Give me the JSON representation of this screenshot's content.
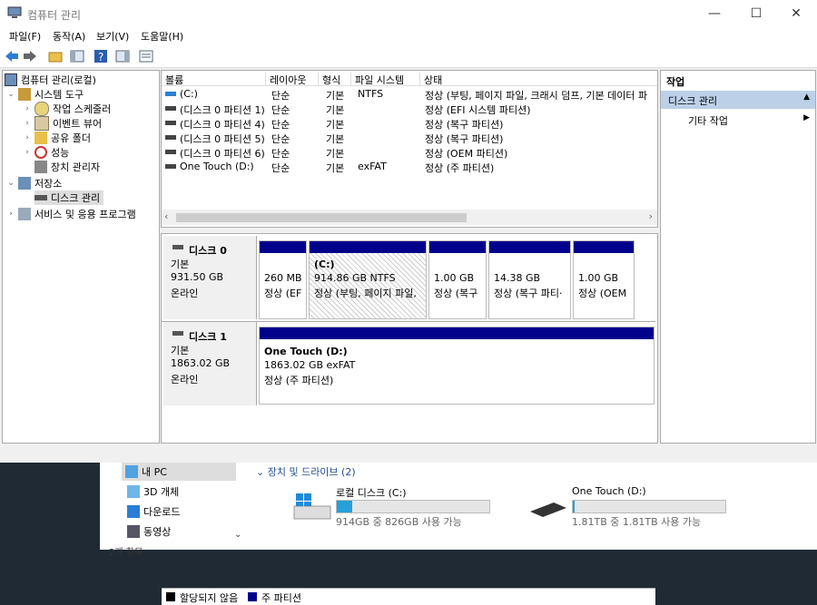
{
  "window": {
    "title": "컴퓨터 관리"
  },
  "menu": [
    "파일(F)",
    "동작(A)",
    "보기(V)",
    "도움말(H)"
  ],
  "tree": {
    "root": "컴퓨터 관리(로컬)",
    "system_tools": "시스템 도구",
    "items": [
      "작업 스케줄러",
      "이벤트 뷰어",
      "공유 폴더",
      "성능",
      "장치 관리자"
    ],
    "storage": "저장소",
    "disk_mgmt": "디스크 관리",
    "services": "서비스 및 응용 프로그램"
  },
  "volumes": {
    "headers": [
      "볼륨",
      "레이아웃",
      "형식",
      "파일 시스템",
      "상태"
    ],
    "rows": [
      [
        "(C:)",
        "단순",
        "기본",
        "NTFS",
        "정상 (부팅, 페이지 파일, 크래시 덤프, 기본 데이터 파"
      ],
      [
        "(디스크 0 파티션 1)",
        "단순",
        "기본",
        "",
        "정상 (EFI 시스템 파티션)"
      ],
      [
        "(디스크 0 파티션 4)",
        "단순",
        "기본",
        "",
        "정상 (복구 파티션)"
      ],
      [
        "(디스크 0 파티션 5)",
        "단순",
        "기본",
        "",
        "정상 (복구 파티션)"
      ],
      [
        "(디스크 0 파티션 6)",
        "단순",
        "기본",
        "",
        "정상 (OEM 파티션)"
      ],
      [
        "One Touch (D:)",
        "단순",
        "기본",
        "exFAT",
        "정상 (주 파티션)"
      ]
    ]
  },
  "disks": [
    {
      "name": "디스크 0",
      "type": "기본",
      "size": "931.50 GB",
      "status": "온라인",
      "parts": [
        {
          "label": "",
          "size": "260 MB",
          "status": "정상 (EF"
        },
        {
          "label": "(C:)",
          "size": "914.86 GB NTFS",
          "status": "정상 (부팅, 페이지 파일,"
        },
        {
          "label": "",
          "size": "1.00 GB",
          "status": "정상 (복구"
        },
        {
          "label": "",
          "size": "14.38 GB",
          "status": "정상 (복구 파티·"
        },
        {
          "label": "",
          "size": "1.00 GB",
          "status": "정상 (OEM"
        }
      ]
    },
    {
      "name": "디스크 1",
      "type": "기본",
      "size": "1863.02 GB",
      "status": "온라인",
      "parts": [
        {
          "label": "One Touch  (D:)",
          "size": "1863.02 GB exFAT",
          "status": "정상 (주 파티션)"
        }
      ]
    }
  ],
  "legend": [
    "할당되지 않음",
    "주 파티션"
  ],
  "actions": {
    "header": "작업",
    "section": "디스크 관리",
    "more": "기타 작업"
  },
  "explorer": {
    "nav": [
      "내 PC",
      "3D 개체",
      "다운로드",
      "동영상"
    ],
    "group": "장치 및 드라이브 (2)",
    "drives": [
      {
        "name": "로컬 디스크 (C:)",
        "free": "914GB 중 826GB 사용 가능",
        "used": 0.1
      },
      {
        "name": "One Touch (D:)",
        "free": "1.81TB 중 1.81TB 사용 가능",
        "used": 0.01
      }
    ],
    "bottom": "2개 항목"
  },
  "colors": {
    "primary": "#00008b",
    "selection": "#bcd0e8"
  }
}
